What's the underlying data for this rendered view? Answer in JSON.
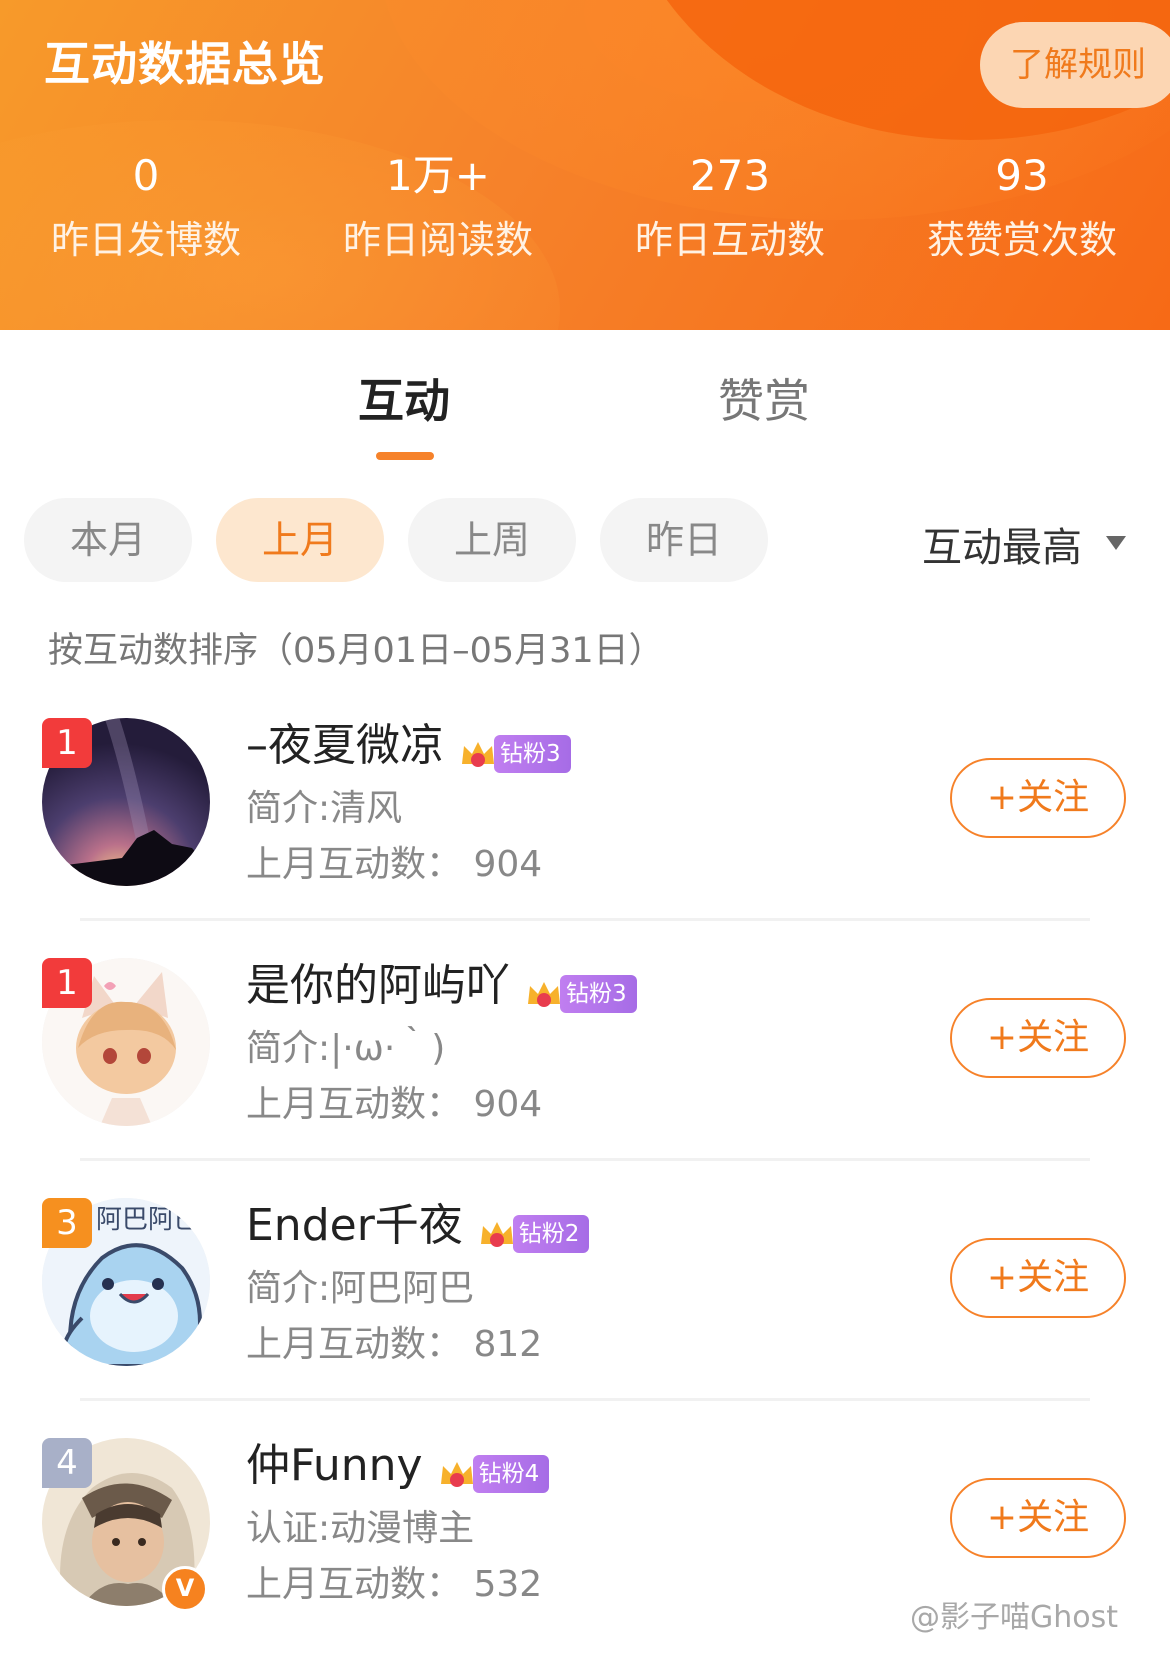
{
  "header": {
    "title": "互动数据总览",
    "rules_button": "了解规则",
    "stats": [
      {
        "value": "0",
        "label": "昨日发博数"
      },
      {
        "value": "1万+",
        "label": "昨日阅读数"
      },
      {
        "value": "273",
        "label": "昨日互动数"
      },
      {
        "value": "93",
        "label": "获赞赏次数"
      }
    ]
  },
  "tabs": [
    {
      "label": "互动",
      "active": true
    },
    {
      "label": "赞赏",
      "active": false
    }
  ],
  "filters": [
    {
      "label": "本月",
      "active": false
    },
    {
      "label": "上月",
      "active": true
    },
    {
      "label": "上周",
      "active": false
    },
    {
      "label": "昨日",
      "active": false
    }
  ],
  "sort": {
    "selected": "互动最高"
  },
  "subtitle": "按互动数排序（05月01日–05月31日）",
  "follow_label": "+关注",
  "fans": [
    {
      "rank": "1",
      "name": "–夜夏微凉",
      "badge": "钻粉3",
      "intro": "简介:清风",
      "count": "上月互动数：  904"
    },
    {
      "rank": "1",
      "name": "是你的阿屿吖",
      "badge": "钻粉3",
      "intro": "简介:|·ω·｀)",
      "count": "上月互动数：  904"
    },
    {
      "rank": "3",
      "name": "Ender千夜",
      "badge": "钻粉2",
      "intro": "简介:阿巴阿巴",
      "count": "上月互动数：  812"
    },
    {
      "rank": "4",
      "name": "仲Funny",
      "badge": "钻粉4",
      "intro": "认证:动漫博主",
      "count": "上月互动数：  532",
      "verified": "V"
    }
  ],
  "avatar_text": "阿巴阿巴",
  "watermark": "@影子喵Ghost",
  "colors": {
    "accent": "#f6822a",
    "rank_red": "#f23b3b",
    "rank_orange": "#f6901f",
    "rank_gray": "#a8b0c8",
    "badge_purple": "#b076ea"
  }
}
